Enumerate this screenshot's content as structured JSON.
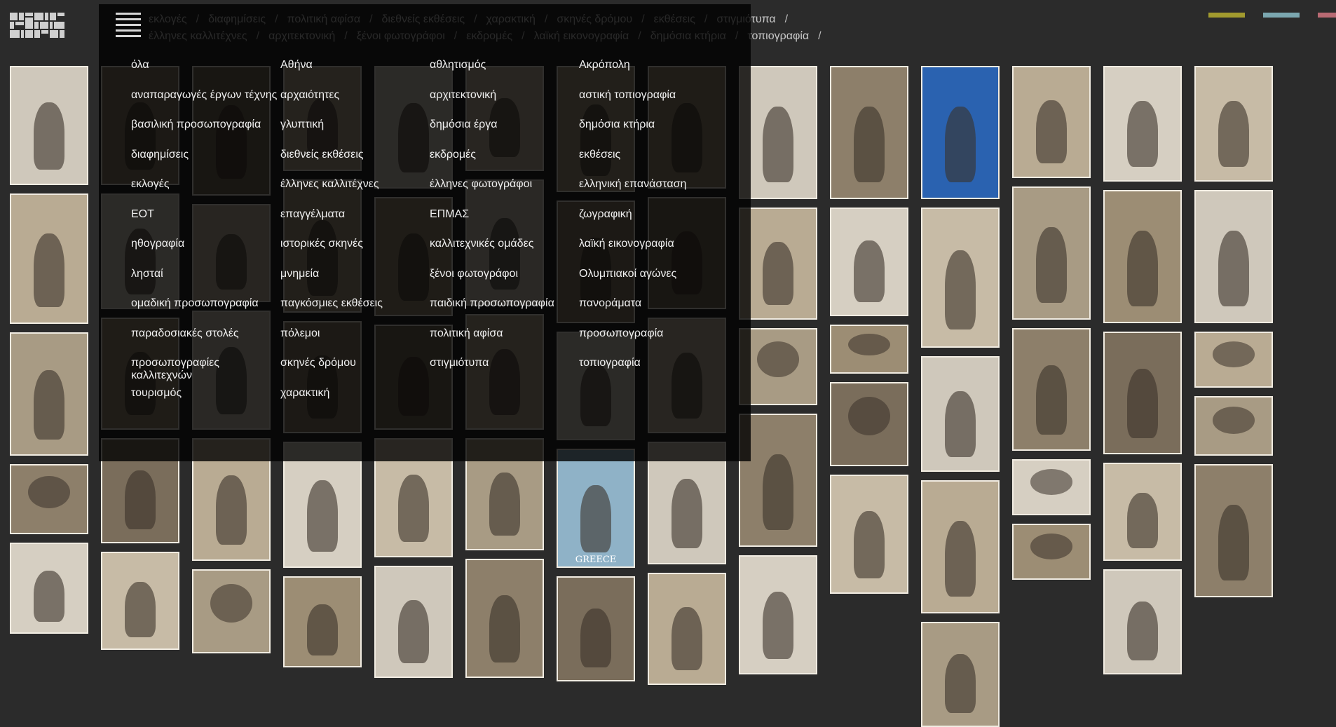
{
  "tag_rows": [
    [
      "εκλογές",
      "διαφημίσεις",
      "πολιτική αφίσα",
      "διεθνείς εκθέσεις",
      "χαρακτική",
      "σκηνές δρόμου",
      "εκθέσεις",
      "στιγμιότυπα"
    ],
    [
      "έλληνες καλλιτέχνες",
      "αρχιτεκτονική",
      "ξένοι φωτογράφοι",
      "εκδρομές",
      "λαϊκή εικονογραφία",
      "δημόσια κτήρια",
      "τοπιογραφία"
    ]
  ],
  "separator": "/",
  "swatch_colors": [
    "#a19a2e",
    "#7ba7b0",
    "#b96a73"
  ],
  "menu_items": [
    "όλα",
    "Αθήνα",
    "αθλητισμός",
    "Ακρόπολη",
    "αναπαραγωγές έργων τέχνης",
    "αρχαιότητες",
    "αρχιτεκτονική",
    "αστική τοπιογραφία",
    "βασιλική προσωπογραφία",
    "γλυπτική",
    "δημόσια έργα",
    "δημόσια κτήρια",
    "διαφημίσεις",
    "διεθνείς εκθέσεις",
    "εκδρομές",
    "εκθέσεις",
    "εκλογές",
    "έλληνες καλλιτέχνες",
    "έλληνες φωτογράφοι",
    "ελληνική επανάσταση",
    "ΕΟΤ",
    "επαγγέλματα",
    "ΕΠΜΑΣ",
    "ζωγραφική",
    "ηθογραφία",
    "ιστορικές σκηνές",
    "καλλιτεχνικές ομάδες",
    "λαϊκή εικονογραφία",
    "λησταί",
    "μνημεία",
    "ξένοι φωτογράφοι",
    "Ολυμπιακοί αγώνες",
    "ομαδική προσωπογραφία",
    "παγκόσμιες εκθέσεις",
    "παιδική προσωπογραφία",
    "πανοράματα",
    "παραδοσιακές στολές",
    "πόλεμοι",
    "πολιτική αφίσα",
    "προσωπογραφία",
    "προσωπογραφίες καλλιτεχνών",
    "σκηνές δρόμου",
    "στιγμιότυπα",
    "τοπιογραφία",
    "τουρισμός",
    "χαρακτική",
    "",
    ""
  ],
  "photo_caption": "GREECE"
}
